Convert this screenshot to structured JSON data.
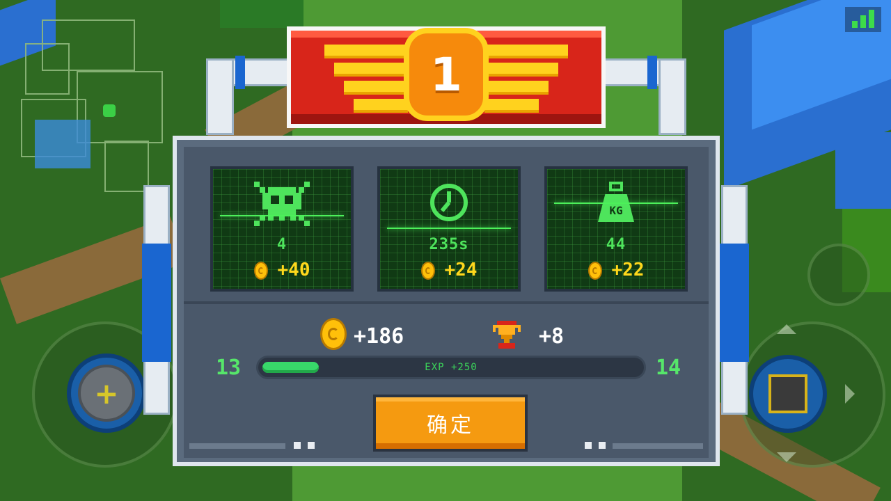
{
  "banner": {
    "rank": "1"
  },
  "stats": [
    {
      "name": "kills",
      "icon": "skull-icon",
      "value": "4",
      "reward": "+40"
    },
    {
      "name": "time",
      "icon": "clock-icon",
      "value": "235s",
      "reward": "+24"
    },
    {
      "name": "weight",
      "icon": "weight-icon",
      "icon_text": "KG",
      "value": "44",
      "reward": "+22"
    }
  ],
  "summary": {
    "coins": "+186",
    "trophies": "+8"
  },
  "level": {
    "current": "13",
    "next": "14",
    "exp_label": "EXP +250",
    "progress": 0.15
  },
  "confirm_label": "确定",
  "colors": {
    "accent_green": "#4ee45c",
    "coin_gold": "#ffd81c",
    "button_orange": "#f59a10",
    "banner_red": "#d8251a"
  }
}
